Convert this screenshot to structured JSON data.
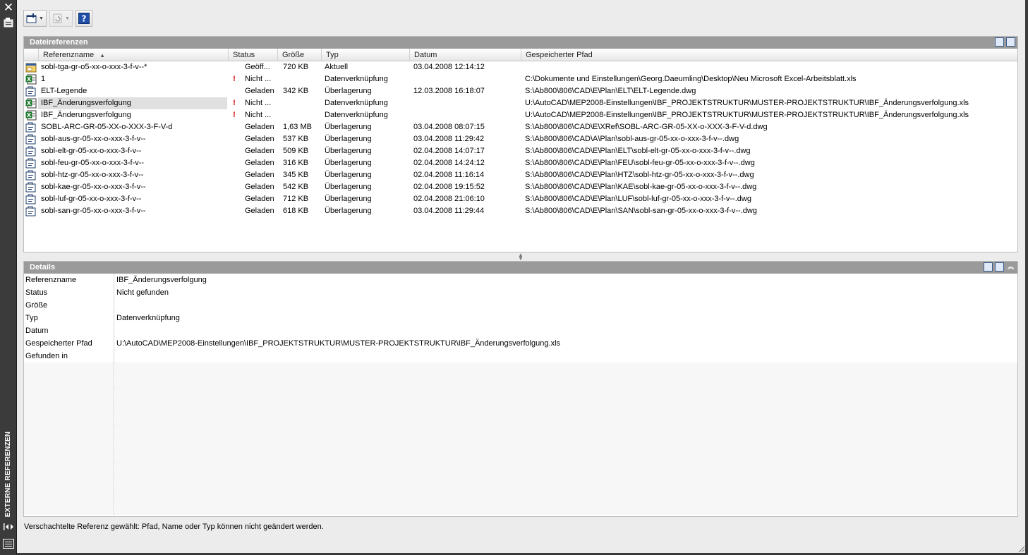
{
  "palette": {
    "title": "EXTERNE REFERENZEN"
  },
  "references_panel": {
    "title": "Dateireferenzen",
    "columns": [
      "Referenzname",
      "Status",
      "Größe",
      "Typ",
      "Datum",
      "Gespeicherter Pfad"
    ],
    "sort_column": "Referenzname",
    "rows": [
      {
        "icon": "dwg-drawing-icon",
        "name": "sobl-tga-gr-o5-xx-o-xxx-3-f-v--*",
        "warn": "",
        "status": "Geöff...",
        "size": "720 KB",
        "type": "Aktuell",
        "date": "03.04.2008 12:14:12",
        "path": ""
      },
      {
        "icon": "excel-file-icon",
        "name": "1",
        "warn": "!",
        "status": "Nicht ...",
        "size": "",
        "type": "Datenverknüpfung",
        "date": "",
        "path": "C:\\Dokumente und Einstellungen\\Georg.Daeumling\\Desktop\\Neu Microsoft Excel-Arbeitsblatt.xls"
      },
      {
        "icon": "xref-overlay-icon",
        "name": "ELT-Legende",
        "warn": "",
        "status": "Geladen",
        "size": "342 KB",
        "type": "Überlagerung",
        "date": "12.03.2008 16:18:07",
        "path": "S:\\Ab800\\806\\CAD\\E\\Plan\\ELT\\ELT-Legende.dwg"
      },
      {
        "icon": "excel-file-icon",
        "name": "IBF_Änderungsverfolgung",
        "warn": "!",
        "status": "Nicht ...",
        "size": "",
        "type": "Datenverknüpfung",
        "date": "",
        "path": "U:\\AutoCAD\\MEP2008-Einstellungen\\IBF_PROJEKTSTRUKTUR\\MUSTER-PROJEKTSTRUKTUR\\IBF_Änderungsverfolgung.xls",
        "selected": true
      },
      {
        "icon": "excel-file-icon",
        "name": "IBF_Änderungsverfolgung",
        "warn": "!",
        "status": "Nicht ...",
        "size": "",
        "type": "Datenverknüpfung",
        "date": "",
        "path": "U:\\AutoCAD\\MEP2008-Einstellungen\\IBF_PROJEKTSTRUKTUR\\MUSTER-PROJEKTSTRUKTUR\\IBF_Änderungsverfolgung.xls"
      },
      {
        "icon": "xref-overlay-icon",
        "name": "SOBL-ARC-GR-05-XX-o-XXX-3-F-V-d",
        "warn": "",
        "status": "Geladen",
        "size": "1,63 MB",
        "type": "Überlagerung",
        "date": "03.04.2008 08:07:15",
        "path": "S:\\Ab800\\806\\CAD\\E\\XRef\\SOBL-ARC-GR-05-XX-o-XXX-3-F-V-d.dwg"
      },
      {
        "icon": "xref-overlay-icon",
        "name": "sobl-aus-gr-05-xx-o-xxx-3-f-v--",
        "warn": "",
        "status": "Geladen",
        "size": "537 KB",
        "type": "Überlagerung",
        "date": "03.04.2008 11:29:42",
        "path": "S:\\Ab800\\806\\CAD\\A\\Plan\\sobl-aus-gr-05-xx-o-xxx-3-f-v--.dwg"
      },
      {
        "icon": "xref-overlay-icon",
        "name": "sobl-elt-gr-05-xx-o-xxx-3-f-v--",
        "warn": "",
        "status": "Geladen",
        "size": "509 KB",
        "type": "Überlagerung",
        "date": "02.04.2008 14:07:17",
        "path": "S:\\Ab800\\806\\CAD\\E\\Plan\\ELT\\sobl-elt-gr-05-xx-o-xxx-3-f-v--.dwg"
      },
      {
        "icon": "xref-overlay-icon",
        "name": "sobl-feu-gr-05-xx-o-xxx-3-f-v--",
        "warn": "",
        "status": "Geladen",
        "size": "316 KB",
        "type": "Überlagerung",
        "date": "02.04.2008 14:24:12",
        "path": "S:\\Ab800\\806\\CAD\\E\\Plan\\FEU\\sobl-feu-gr-05-xx-o-xxx-3-f-v--.dwg"
      },
      {
        "icon": "xref-overlay-icon",
        "name": "sobl-htz-gr-05-xx-o-xxx-3-f-v--",
        "warn": "",
        "status": "Geladen",
        "size": "345 KB",
        "type": "Überlagerung",
        "date": "02.04.2008 11:16:14",
        "path": "S:\\Ab800\\806\\CAD\\E\\Plan\\HTZ\\sobl-htz-gr-05-xx-o-xxx-3-f-v--.dwg"
      },
      {
        "icon": "xref-overlay-icon",
        "name": "sobl-kae-gr-05-xx-o-xxx-3-f-v--",
        "warn": "",
        "status": "Geladen",
        "size": "542 KB",
        "type": "Überlagerung",
        "date": "02.04.2008 19:15:52",
        "path": "S:\\Ab800\\806\\CAD\\E\\Plan\\KAE\\sobl-kae-gr-05-xx-o-xxx-3-f-v--.dwg"
      },
      {
        "icon": "xref-overlay-icon",
        "name": "sobl-luf-gr-05-xx-o-xxx-3-f-v--",
        "warn": "",
        "status": "Geladen",
        "size": "712 KB",
        "type": "Überlagerung",
        "date": "02.04.2008 21:06:10",
        "path": "S:\\Ab800\\806\\CAD\\E\\Plan\\LUF\\sobl-luf-gr-05-xx-o-xxx-3-f-v--.dwg"
      },
      {
        "icon": "xref-overlay-icon",
        "name": "sobl-san-gr-05-xx-o-xxx-3-f-v--",
        "warn": "",
        "status": "Geladen",
        "size": "618 KB",
        "type": "Überlagerung",
        "date": "03.04.2008 11:29:44",
        "path": "S:\\Ab800\\806\\CAD\\E\\Plan\\SAN\\sobl-san-gr-05-xx-o-xxx-3-f-v--.dwg"
      }
    ]
  },
  "details_panel": {
    "title": "Details",
    "fields": [
      {
        "label": "Referenzname",
        "value": "IBF_Änderungsverfolgung"
      },
      {
        "label": "Status",
        "value": "Nicht gefunden"
      },
      {
        "label": "Größe",
        "value": ""
      },
      {
        "label": "Typ",
        "value": "Datenverknüpfung"
      },
      {
        "label": "Datum",
        "value": ""
      },
      {
        "label": "Gespeicherter Pfad",
        "value": "U:\\AutoCAD\\MEP2008-Einstellungen\\IBF_PROJEKTSTRUKTUR\\MUSTER-PROJEKTSTRUKTUR\\IBF_Änderungsverfolgung.xls"
      },
      {
        "label": "Gefunden in",
        "value": ""
      }
    ]
  },
  "status_message": "Verschachtelte Referenz gewählt: Pfad, Name oder Typ können nicht geändert werden.",
  "colors": {
    "palette_bar": "#3b3b3b",
    "panel_header": "#9a9a9a",
    "warning": "#d00000",
    "selection": "#e0e0e0"
  }
}
